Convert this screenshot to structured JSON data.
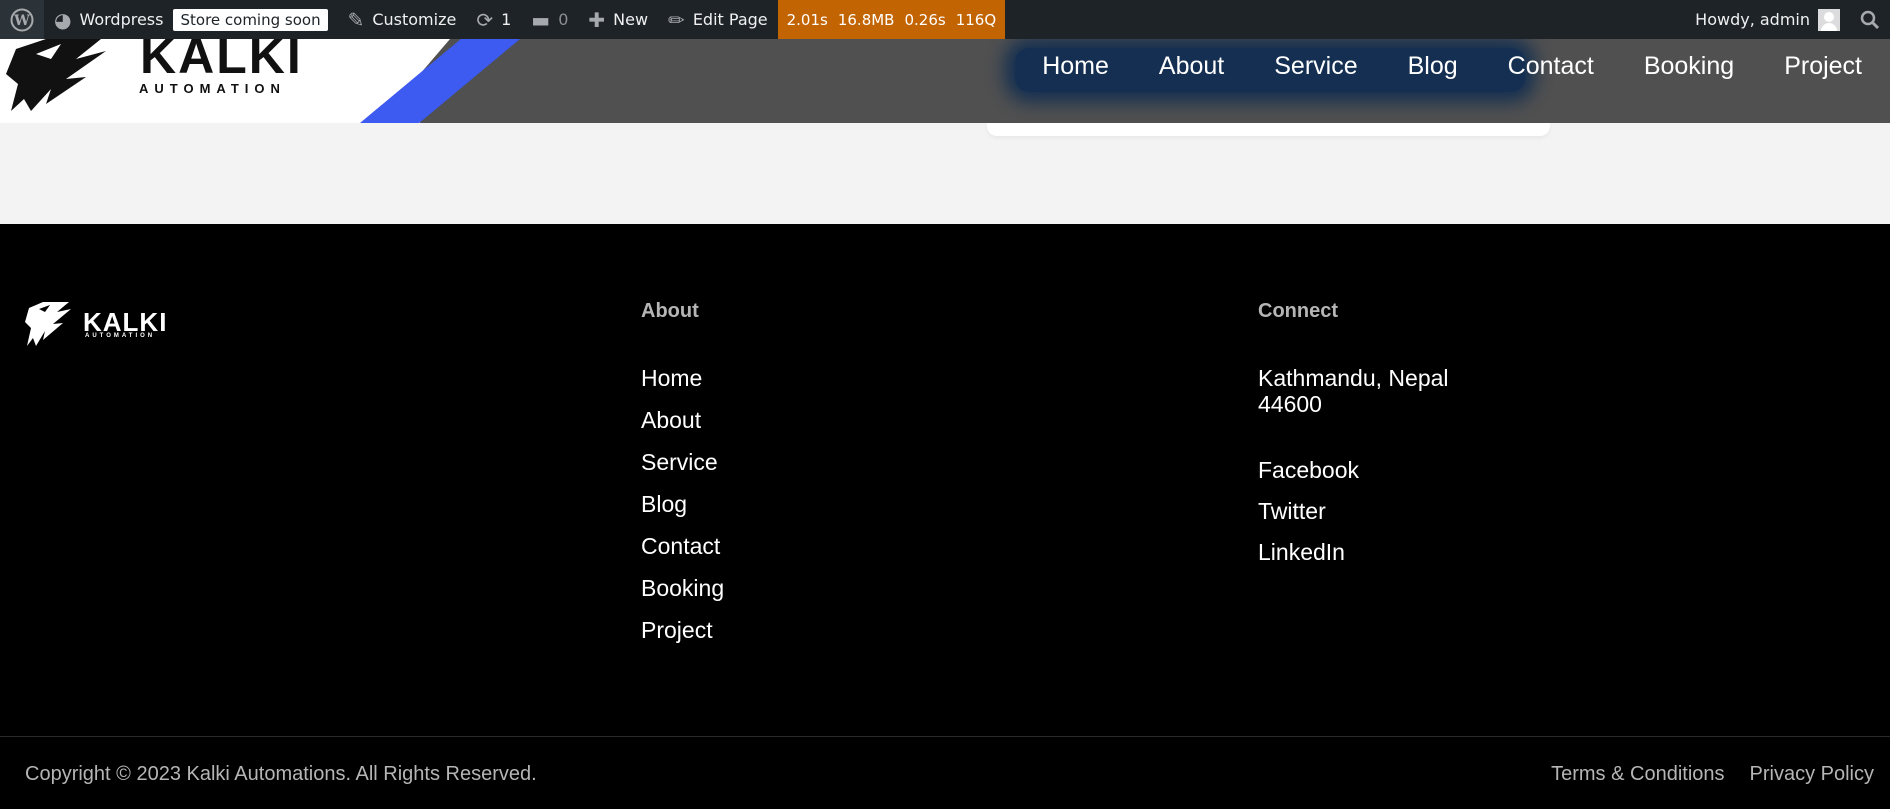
{
  "admin_bar": {
    "site_name": "Wordpress",
    "store_badge": "Store coming soon",
    "customize": "Customize",
    "updates_count": "1",
    "comments_count": "0",
    "new": "New",
    "edit_page": "Edit Page",
    "qm": {
      "time": "2.01s",
      "memory": "16.8MB",
      "db_time": "0.26s",
      "queries": "116Q"
    },
    "greeting": "Howdy, admin"
  },
  "header": {
    "logo_text": "KALKI",
    "logo_sub": "AUTOMATION",
    "nav": [
      "Home",
      "About",
      "Service",
      "Blog",
      "Contact",
      "Booking",
      "Project"
    ]
  },
  "footer": {
    "logo_text": "KALKI",
    "logo_sub": "AUTOMATION",
    "about": {
      "title": "About",
      "links": [
        "Home",
        "About",
        "Service",
        "Blog",
        "Contact",
        "Booking",
        "Project"
      ]
    },
    "connect": {
      "title": "Connect",
      "address_line1": "Kathmandu, Nepal",
      "address_line2": "44600",
      "social": [
        "Facebook",
        "Twitter",
        "LinkedIn"
      ]
    },
    "copyright": "Copyright © 2023 Kalki Automations. All Rights Reserved.",
    "legal": [
      "Terms & Conditions",
      "Privacy Policy"
    ]
  },
  "colors": {
    "admin_bar": "#1d2327",
    "qm": "#c36403",
    "accent_blue": "#3d5af1",
    "footer_bg": "#000000"
  }
}
